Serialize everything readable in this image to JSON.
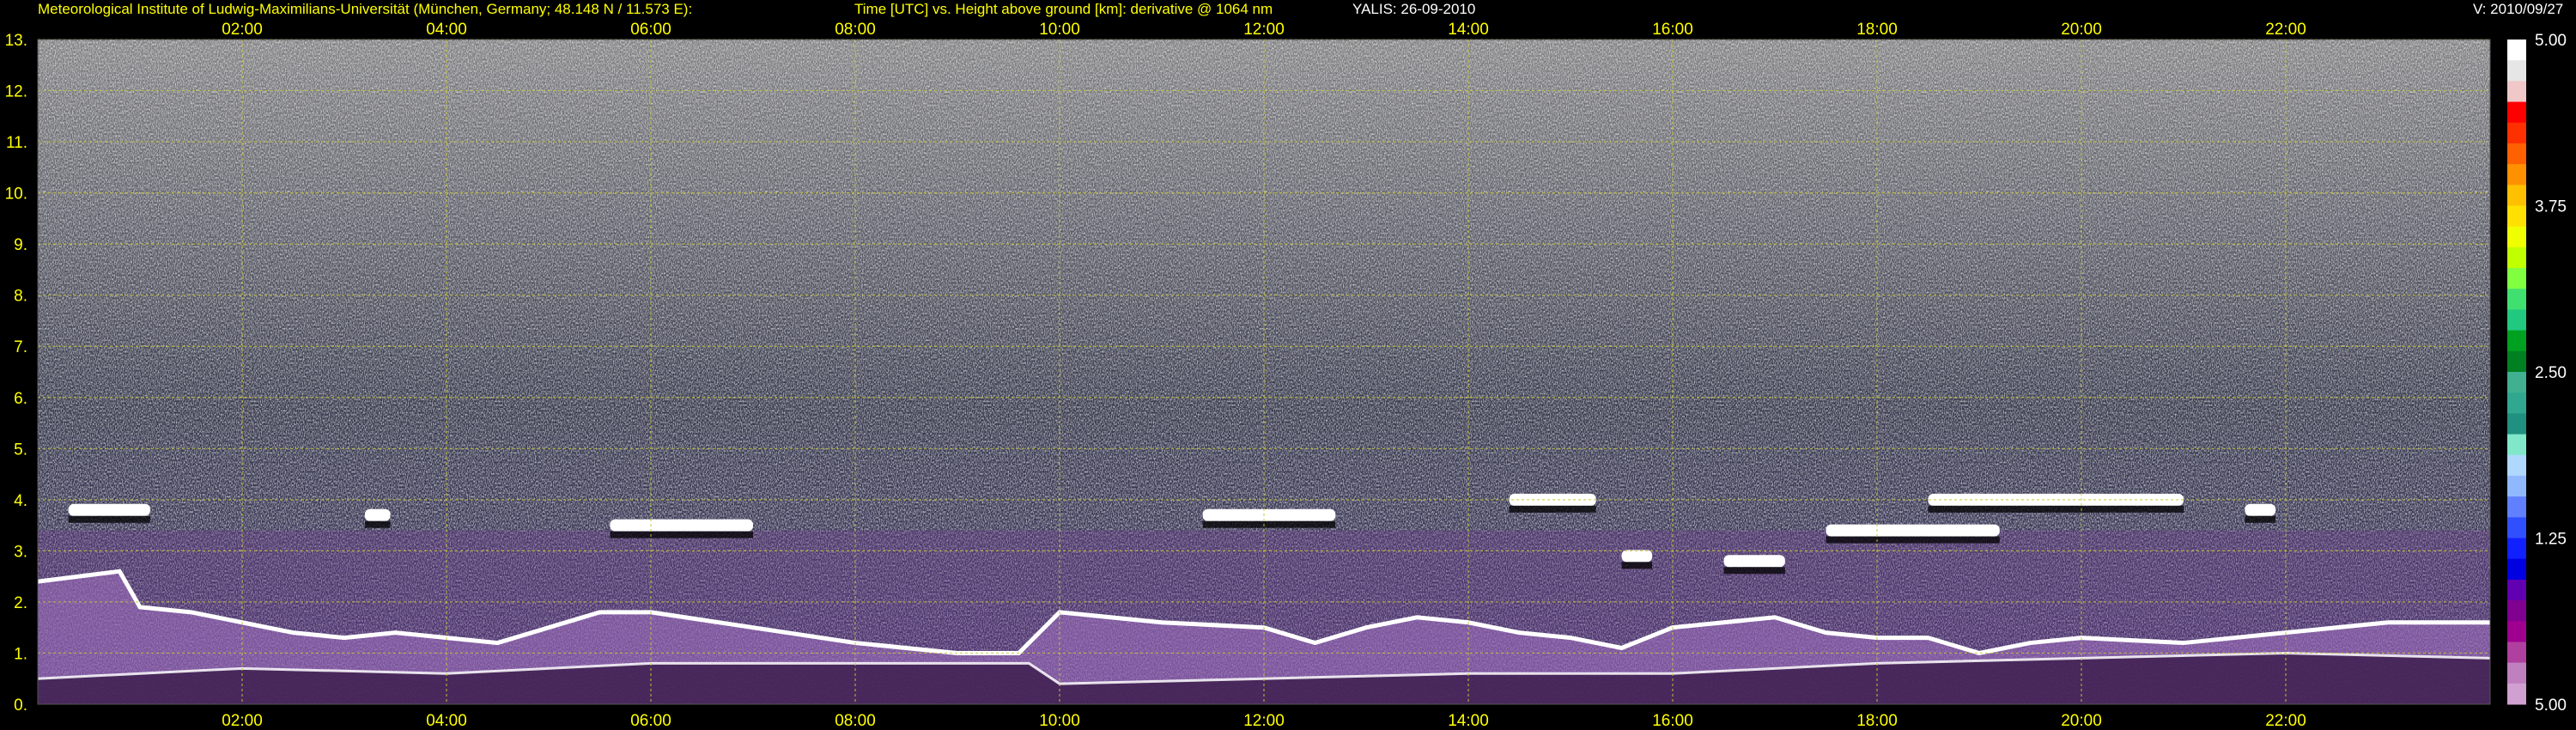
{
  "header": {
    "institute": "Meteorological Institute of Ludwig-Maximilians-Universität (München, Germany; 48.148 N / 11.573 E):",
    "title": "Time [UTC] vs. Height above ground [km]: derivative @ 1064 nm",
    "station": "YALIS: 26-09-2010",
    "version": "V: 2010/09/27"
  },
  "colors": {
    "background": "#000000",
    "text": "#ffff00",
    "grid": "#c8c832",
    "noise_light": "#e6e6e6",
    "noise_mid": "#8a8a8a",
    "lowlevel_aerosol": "#6e3c8c",
    "boundary_layer": "#a070c0",
    "cloud": "#ffffff"
  },
  "chart_data": {
    "type": "heatmap",
    "title": "Time [UTC] vs. Height above ground [km]: derivative @ 1064 nm",
    "x": {
      "unit": "UTC",
      "range": [
        "00:00",
        "24:00"
      ],
      "tick_labels": [
        "02:00",
        "04:00",
        "06:00",
        "08:00",
        "10:00",
        "12:00",
        "14:00",
        "16:00",
        "18:00",
        "20:00",
        "22:00"
      ],
      "tick_hours": [
        2,
        4,
        6,
        8,
        10,
        12,
        14,
        16,
        18,
        20,
        22
      ]
    },
    "y": {
      "unit": "km",
      "range": [
        0,
        13
      ],
      "tick_labels": [
        "0.",
        "1.",
        "2.",
        "3.",
        "4.",
        "5.",
        "6.",
        "7.",
        "8.",
        "9.",
        "10.",
        "11.",
        "12.",
        "13."
      ],
      "tick_values": [
        0,
        1,
        2,
        3,
        4,
        5,
        6,
        7,
        8,
        9,
        10,
        11,
        12,
        13
      ]
    },
    "grid": true,
    "colorbar": {
      "position": "right",
      "tick_labels": [
        "5.00",
        "3.75",
        "2.50",
        "1.25",
        "5.00"
      ],
      "tick_values": [
        5.0,
        3.75,
        2.5,
        1.25,
        0
      ],
      "colors": [
        "#ffffff",
        "#e6e6e6",
        "#f0c8c8",
        "#ff0000",
        "#ff3000",
        "#ff6000",
        "#ff9000",
        "#ffc000",
        "#ffe000",
        "#f0ff00",
        "#c0ff00",
        "#80ff40",
        "#40e070",
        "#20c880",
        "#00a020",
        "#008020",
        "#40b090",
        "#30a890",
        "#209080",
        "#80e8c8",
        "#b0d8ff",
        "#90b8ff",
        "#6080ff",
        "#3050ff",
        "#1020ff",
        "#0000e0",
        "#6000b0",
        "#800090",
        "#a00090",
        "#b040a0",
        "#c080c0",
        "#d0a0d0"
      ]
    },
    "cloud_layers": [
      {
        "start": 0.3,
        "end": 1.1,
        "height": 3.8
      },
      {
        "start": 3.2,
        "end": 3.45,
        "height": 3.7
      },
      {
        "start": 5.6,
        "end": 7.0,
        "height": 3.5
      },
      {
        "start": 11.4,
        "end": 12.7,
        "height": 3.7
      },
      {
        "start": 14.4,
        "end": 15.25,
        "height": 4.0
      },
      {
        "start": 15.5,
        "end": 15.8,
        "height": 2.9
      },
      {
        "start": 16.5,
        "end": 17.1,
        "height": 2.8
      },
      {
        "start": 17.5,
        "end": 19.2,
        "height": 3.4
      },
      {
        "start": 18.5,
        "end": 21.0,
        "height": 4.0
      },
      {
        "start": 21.6,
        "end": 21.9,
        "height": 3.8
      }
    ],
    "boundary_layer_top": [
      [
        0.0,
        2.4
      ],
      [
        0.8,
        2.6
      ],
      [
        1.0,
        1.9
      ],
      [
        1.5,
        1.8
      ],
      [
        2.0,
        1.6
      ],
      [
        2.5,
        1.4
      ],
      [
        3.0,
        1.3
      ],
      [
        3.5,
        1.4
      ],
      [
        4.0,
        1.3
      ],
      [
        4.5,
        1.2
      ],
      [
        5.0,
        1.5
      ],
      [
        5.5,
        1.8
      ],
      [
        6.0,
        1.8
      ],
      [
        7.0,
        1.5
      ],
      [
        8.0,
        1.2
      ],
      [
        9.0,
        1.0
      ],
      [
        9.6,
        1.0
      ],
      [
        10.0,
        1.8
      ],
      [
        11.0,
        1.6
      ],
      [
        12.0,
        1.5
      ],
      [
        12.5,
        1.2
      ],
      [
        13.0,
        1.5
      ],
      [
        13.5,
        1.7
      ],
      [
        14.0,
        1.6
      ],
      [
        14.5,
        1.4
      ],
      [
        15.0,
        1.3
      ],
      [
        15.5,
        1.1
      ],
      [
        16.0,
        1.5
      ],
      [
        17.0,
        1.7
      ],
      [
        17.5,
        1.4
      ],
      [
        18.0,
        1.3
      ],
      [
        18.5,
        1.3
      ],
      [
        19.0,
        1.0
      ],
      [
        19.5,
        1.2
      ],
      [
        20.0,
        1.3
      ],
      [
        21.0,
        1.2
      ],
      [
        22.0,
        1.4
      ],
      [
        23.0,
        1.6
      ],
      [
        24.0,
        1.6
      ]
    ],
    "surface_layer_top": [
      [
        0.0,
        0.5
      ],
      [
        2.0,
        0.7
      ],
      [
        4.0,
        0.6
      ],
      [
        6.0,
        0.8
      ],
      [
        8.0,
        0.8
      ],
      [
        9.7,
        0.8
      ],
      [
        10.0,
        0.4
      ],
      [
        12.0,
        0.5
      ],
      [
        14.0,
        0.6
      ],
      [
        16.0,
        0.6
      ],
      [
        18.0,
        0.8
      ],
      [
        20.0,
        0.9
      ],
      [
        22.0,
        1.0
      ],
      [
        24.0,
        0.9
      ]
    ]
  }
}
